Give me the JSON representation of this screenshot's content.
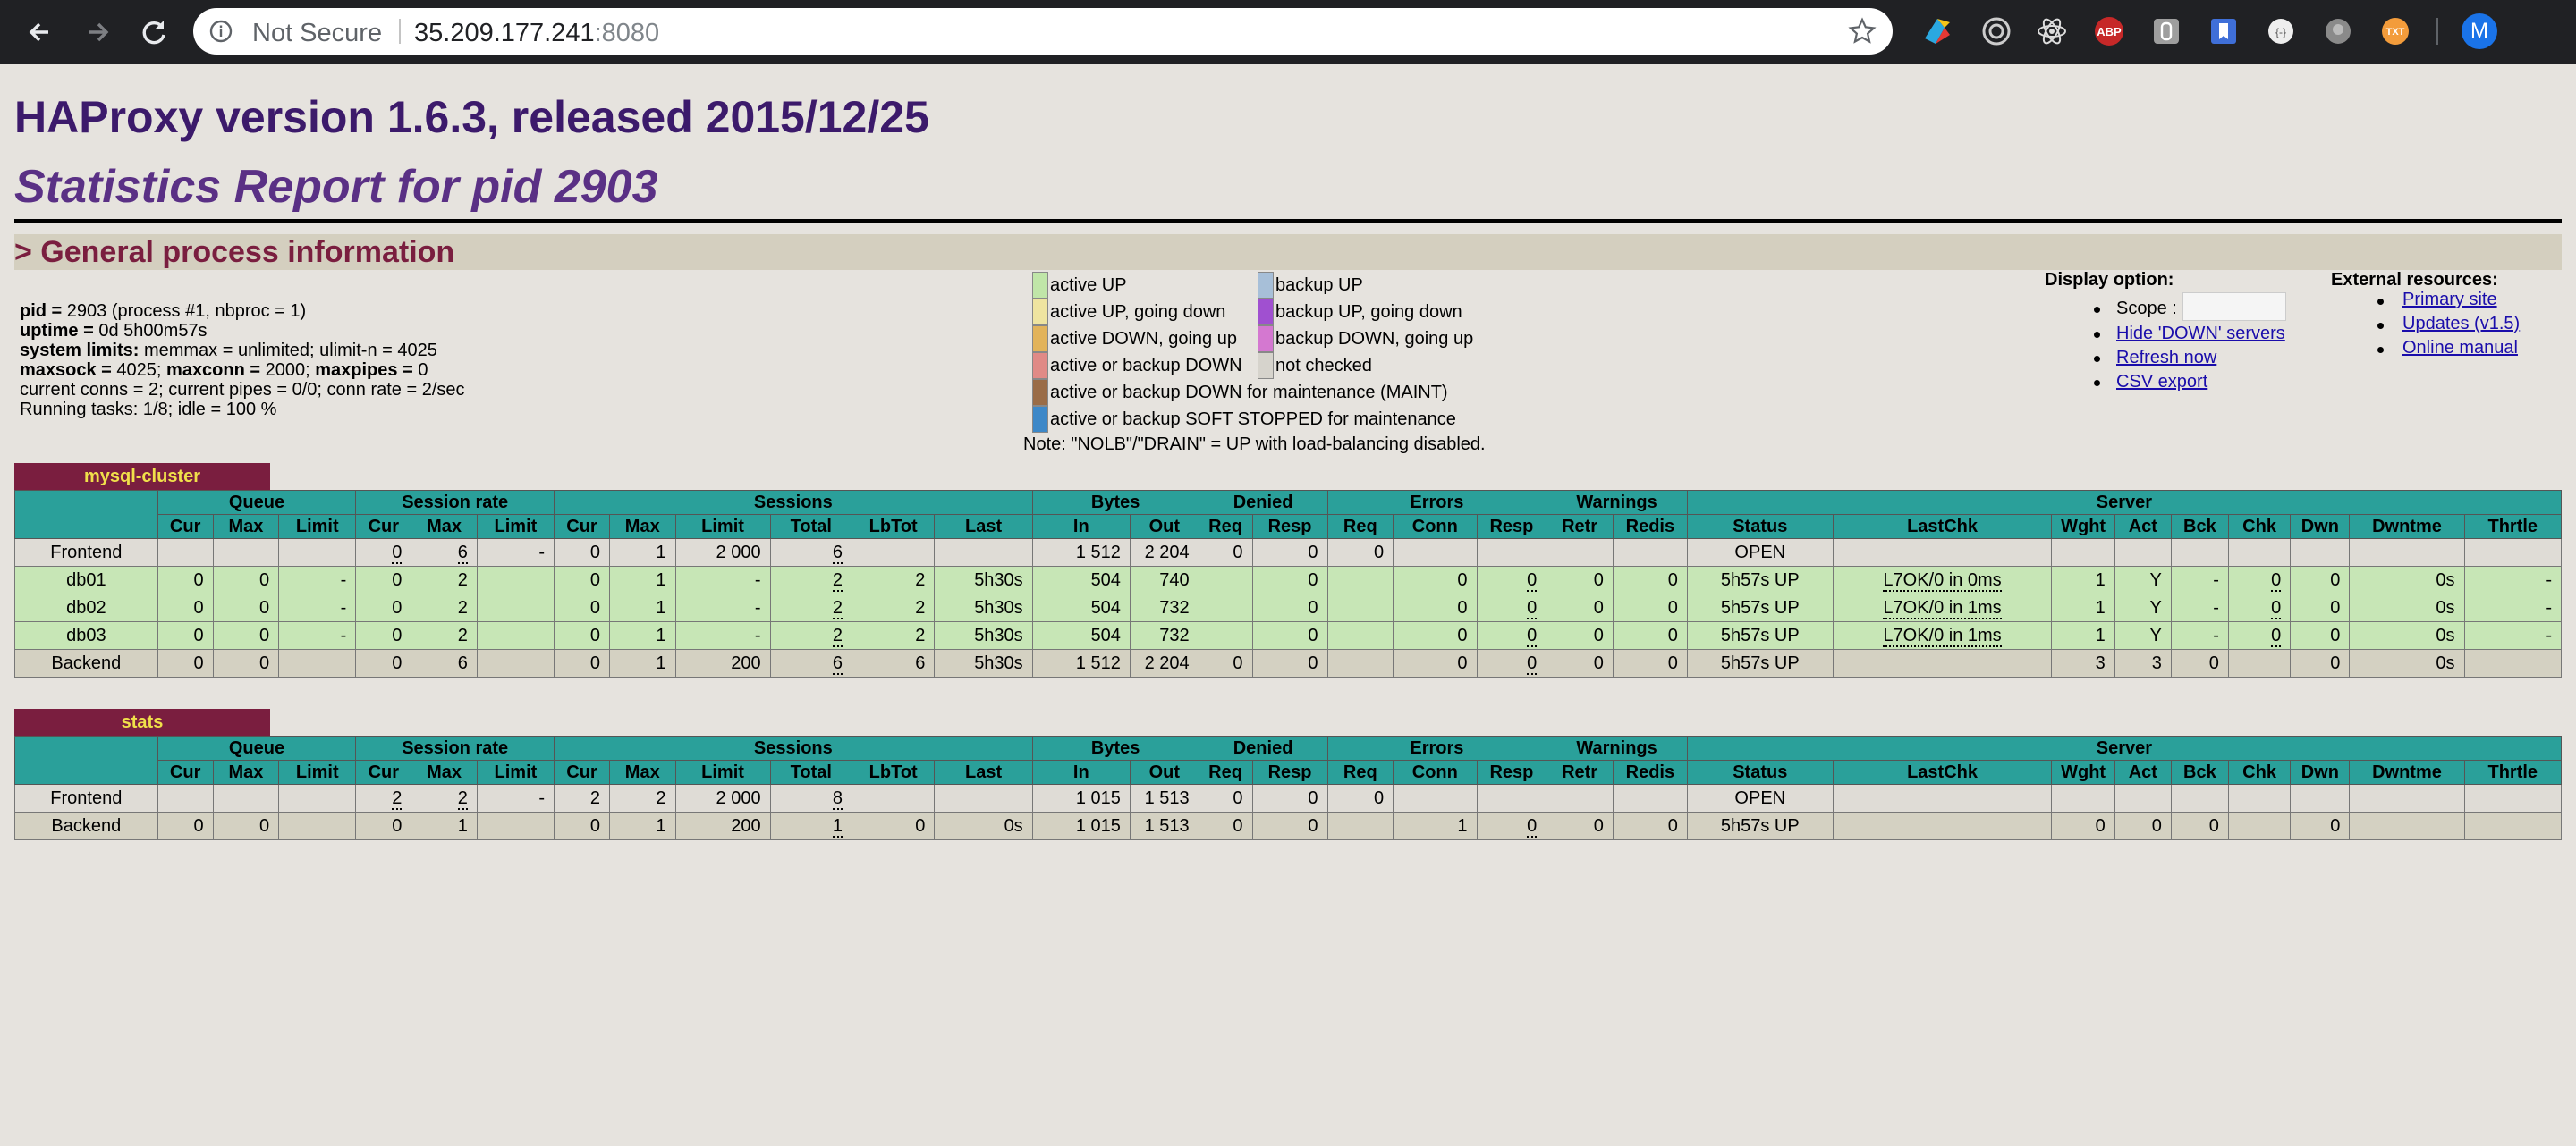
{
  "browser": {
    "security_label": "Not Secure",
    "url_host": "35.209.177.241",
    "url_port": ":8080",
    "icons": [
      "back-icon",
      "forward-icon",
      "reload-icon",
      "info-icon",
      "star-icon",
      "extension-icons",
      "profile-avatar"
    ],
    "avatar_letter": "M"
  },
  "header": {
    "title": "HAProxy version 1.6.3, released 2015/12/25",
    "subtitle": "Statistics Report for pid 2903",
    "section": "> General process information"
  },
  "process": {
    "line1_k": "pid = ",
    "line1_v": "2903 (process #1, nbproc = 1)",
    "line2_k": "uptime = ",
    "line2_v": "0d 5h00m57s",
    "line3_k": "system limits: ",
    "line3_v": "memmax = unlimited; ulimit-n = 4025",
    "line4_k1": "maxsock = ",
    "line4_v1": "4025; ",
    "line4_k2": "maxconn = ",
    "line4_v2": "2000; ",
    "line4_k3": "maxpipes = ",
    "line4_v3": "0",
    "line5": "current conns = 2; current pipes = 0/0; conn rate = 2/sec",
    "line6": "Running tasks: 1/8; idle = 100 %"
  },
  "legend": {
    "left": [
      {
        "label": "active UP",
        "color": "#c0e6a8"
      },
      {
        "label": "active UP, going down",
        "color": "#efe4a0"
      },
      {
        "label": "active DOWN, going up",
        "color": "#e2b35a"
      },
      {
        "label": "active or backup DOWN",
        "color": "#e08a86"
      },
      {
        "label": "active or backup DOWN for maintenance (MAINT)",
        "color": "#9a6c46"
      },
      {
        "label": "active or backup SOFT STOPPED for maintenance",
        "color": "#3d88c8"
      }
    ],
    "right": [
      {
        "label": "backup UP",
        "color": "#a7bfd8"
      },
      {
        "label": "backup UP, going down",
        "color": "#a050d0"
      },
      {
        "label": "backup DOWN, going up",
        "color": "#d478d0"
      },
      {
        "label": "not checked",
        "color": "#d6d3cc"
      }
    ],
    "note": "Note: \"NOLB\"/\"DRAIN\" = UP with load-balancing disabled."
  },
  "display_option": {
    "heading": "Display option:",
    "scope_label": "Scope :",
    "scope_value": "",
    "links": [
      "Hide 'DOWN' servers",
      "Refresh now",
      "CSV export"
    ]
  },
  "external": {
    "heading": "External resources:",
    "links": [
      "Primary site",
      "Updates (v1.5)",
      "Online manual"
    ]
  },
  "table_headers": {
    "groups": [
      "Queue",
      "Session rate",
      "Sessions",
      "Bytes",
      "Denied",
      "Errors",
      "Warnings",
      "Server"
    ],
    "cols": [
      "Cur",
      "Max",
      "Limit",
      "Cur",
      "Max",
      "Limit",
      "Cur",
      "Max",
      "Limit",
      "Total",
      "LbTot",
      "Last",
      "In",
      "Out",
      "Req",
      "Resp",
      "Req",
      "Conn",
      "Resp",
      "Retr",
      "Redis",
      "Status",
      "LastChk",
      "Wght",
      "Act",
      "Bck",
      "Chk",
      "Dwn",
      "Dwntme",
      "Thrtle"
    ]
  },
  "proxies": [
    {
      "name": "mysql-cluster",
      "rows": [
        {
          "type": "fe",
          "cells": [
            "Frontend",
            "",
            "",
            "",
            "0",
            "6",
            "-",
            "0",
            "1",
            "2 000",
            "6",
            "",
            "",
            "1 512",
            "2 204",
            "0",
            "0",
            "0",
            "",
            "",
            "",
            "",
            "OPEN",
            "",
            "",
            "",
            "",
            "",
            "",
            "",
            ""
          ]
        },
        {
          "type": "sv",
          "cells": [
            "db01",
            "0",
            "0",
            "-",
            "0",
            "2",
            "",
            "0",
            "1",
            "-",
            "2",
            "2",
            "5h30s",
            "504",
            "740",
            "",
            "0",
            "",
            "0",
            "0",
            "0",
            "0",
            "5h57s UP",
            "L7OK/0 in 0ms",
            "1",
            "Y",
            "-",
            "0",
            "0",
            "0s",
            "-"
          ]
        },
        {
          "type": "sv",
          "cells": [
            "db02",
            "0",
            "0",
            "-",
            "0",
            "2",
            "",
            "0",
            "1",
            "-",
            "2",
            "2",
            "5h30s",
            "504",
            "732",
            "",
            "0",
            "",
            "0",
            "0",
            "0",
            "0",
            "5h57s UP",
            "L7OK/0 in 1ms",
            "1",
            "Y",
            "-",
            "0",
            "0",
            "0s",
            "-"
          ]
        },
        {
          "type": "sv",
          "cells": [
            "db03",
            "0",
            "0",
            "-",
            "0",
            "2",
            "",
            "0",
            "1",
            "-",
            "2",
            "2",
            "5h30s",
            "504",
            "732",
            "",
            "0",
            "",
            "0",
            "0",
            "0",
            "0",
            "5h57s UP",
            "L7OK/0 in 1ms",
            "1",
            "Y",
            "-",
            "0",
            "0",
            "0s",
            "-"
          ]
        },
        {
          "type": "be",
          "cells": [
            "Backend",
            "0",
            "0",
            "",
            "0",
            "6",
            "",
            "0",
            "1",
            "200",
            "6",
            "6",
            "5h30s",
            "1 512",
            "2 204",
            "0",
            "0",
            "",
            "0",
            "0",
            "0",
            "0",
            "5h57s UP",
            "",
            "3",
            "3",
            "0",
            "",
            "0",
            "0s",
            ""
          ]
        }
      ]
    },
    {
      "name": "stats",
      "rows": [
        {
          "type": "fe",
          "cells": [
            "Frontend",
            "",
            "",
            "",
            "2",
            "2",
            "-",
            "2",
            "2",
            "2 000",
            "8",
            "",
            "",
            "1 015",
            "1 513",
            "0",
            "0",
            "0",
            "",
            "",
            "",
            "",
            "OPEN",
            "",
            "",
            "",
            "",
            "",
            "",
            "",
            ""
          ]
        },
        {
          "type": "be",
          "cells": [
            "Backend",
            "0",
            "0",
            "",
            "0",
            "1",
            "",
            "0",
            "1",
            "200",
            "1",
            "0",
            "0s",
            "1 015",
            "1 513",
            "0",
            "0",
            "",
            "1",
            "0",
            "0",
            "0",
            "5h57s UP",
            "",
            "0",
            "0",
            "0",
            "",
            "0",
            "",
            ""
          ]
        }
      ]
    }
  ]
}
